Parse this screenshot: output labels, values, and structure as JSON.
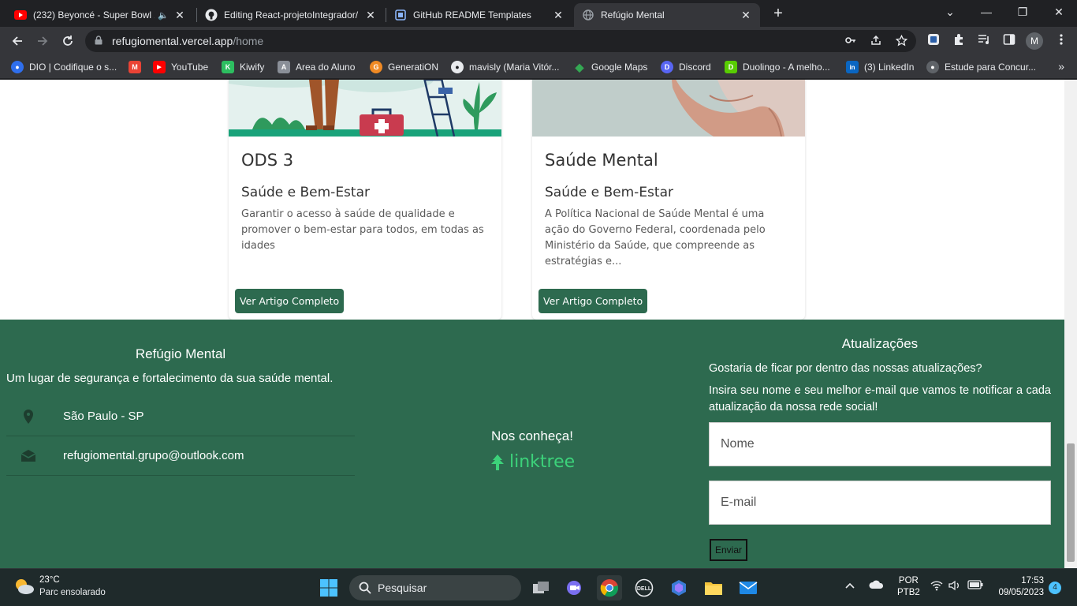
{
  "browser": {
    "tabs": [
      {
        "title": "(232) Beyoncé - Super Bowl X",
        "icon": "youtube-icon",
        "audio": "🔈",
        "close": "✕"
      },
      {
        "title": "Editing React-projetoIntegrador/",
        "icon": "github-icon",
        "close": "✕"
      },
      {
        "title": "GitHub README Templates",
        "icon": "page-icon",
        "close": "✕"
      },
      {
        "title": "Refúgio Mental",
        "icon": "globe-icon",
        "close": "✕"
      }
    ],
    "new_tab": "+",
    "window_controls": {
      "minimize": "—",
      "restore": "❐",
      "close": "✕",
      "tab_search": "⌄"
    },
    "address": {
      "host": "refugiomental.vercel.app",
      "path": "/home"
    },
    "bookmarks": [
      {
        "label": "DIO | Codifique o s...",
        "icon": "dio-icon",
        "color": "#2f6fed",
        "glyph": "●"
      },
      {
        "label": "",
        "icon": "gmail-icon",
        "color": "#ea4335",
        "glyph": "M"
      },
      {
        "label": "YouTube",
        "icon": "youtube-icon",
        "color": "#ff0000",
        "glyph": "▶"
      },
      {
        "label": "Kiwify",
        "icon": "kiwify-icon",
        "color": "#2dbe60",
        "glyph": "K"
      },
      {
        "label": "Area do Aluno",
        "icon": "area-aluno-icon",
        "color": "#8a8f98",
        "glyph": "A"
      },
      {
        "label": "GeneratiON",
        "icon": "generation-icon",
        "color": "#f08a24",
        "glyph": "G"
      },
      {
        "label": "mavisly (Maria Vitór...",
        "icon": "github-icon",
        "color": "#202124",
        "glyph": "●"
      },
      {
        "label": "Google Maps",
        "icon": "maps-pin-icon",
        "color": "#34a853",
        "glyph": "◆"
      },
      {
        "label": "Discord",
        "icon": "discord-icon",
        "color": "#5865f2",
        "glyph": "D"
      },
      {
        "label": "Duolingo - A melho...",
        "icon": "duolingo-icon",
        "color": "#58cc02",
        "glyph": "D"
      },
      {
        "label": "(3) LinkedIn",
        "icon": "linkedin-icon",
        "color": "#0a66c2",
        "glyph": "in"
      },
      {
        "label": "Estude para Concur...",
        "icon": "globe-icon",
        "color": "#5f6368",
        "glyph": "●"
      }
    ],
    "bookmarks_more": "»",
    "profile_initial": "M"
  },
  "page": {
    "cards": [
      {
        "title": "ODS 3",
        "subtitle": "Saúde e Bem-Estar",
        "text": "Garantir o acesso à saúde de qualidade e promover o bem-estar para todos, em todas as idades",
        "button": "Ver Artigo Completo"
      },
      {
        "title": "Saúde Mental",
        "subtitle": "Saúde e Bem-Estar",
        "text": "A Política Nacional de Saúde Mental é uma ação do Governo Federal, coordenada pelo Ministério da Saúde, que compreende as estratégias e...",
        "button": "Ver Artigo Completo"
      }
    ],
    "footer": {
      "brand": "Refúgio Mental",
      "tagline": "Um lugar de segurança e fortalecimento da sua saúde mental.",
      "location": "São Paulo - SP",
      "email": "refugiomental.grupo@outlook.com",
      "meet": "Nos conheça!",
      "linktree": "linktree",
      "updates_title": "Atualizações",
      "updates_question": "Gostaria de ficar por dentro das nossas atualizações?",
      "updates_desc": "Insira seu nome e seu melhor e-mail que vamos te notificar a cada atualização da nossa rede social!",
      "name_placeholder": "Nome",
      "email_placeholder": "E-mail",
      "send": "Enviar",
      "colors": {
        "footer_bg": "#2d6a4f",
        "linktree": "#3cd27a"
      }
    }
  },
  "taskbar": {
    "temperature": "23°C",
    "weather": "Parc ensolarado",
    "search": "Pesquisar",
    "lang_top": "POR",
    "lang_bottom": "PTB2",
    "time": "17:53",
    "date": "09/05/2023",
    "notifications": "4"
  }
}
